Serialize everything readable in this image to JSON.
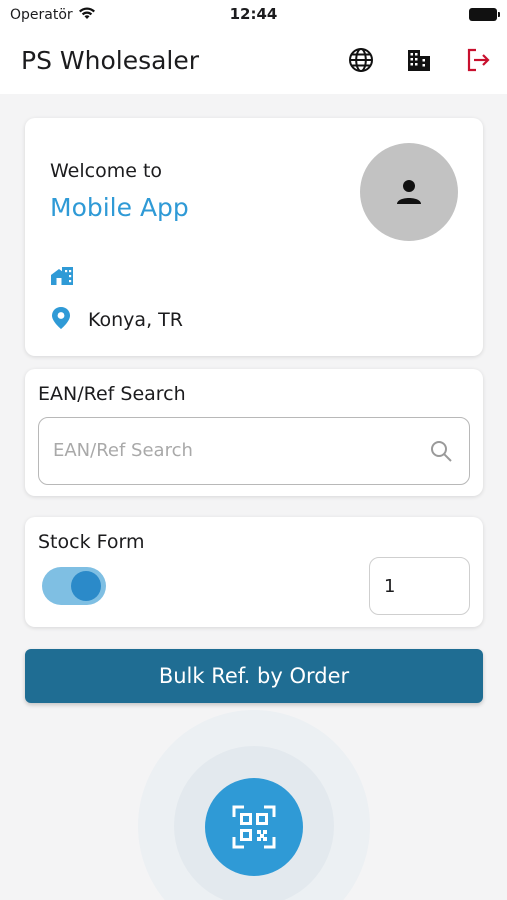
{
  "status_bar": {
    "carrier": "Operatör",
    "time": "12:44"
  },
  "app_bar": {
    "title": "PS Wholesaler",
    "icons": [
      "globe-icon",
      "company-icon",
      "logout-icon"
    ]
  },
  "welcome_card": {
    "welcome_label": "Welcome to",
    "app_name": "Mobile App",
    "location": "Konya, TR"
  },
  "search_card": {
    "title": "EAN/Ref Search",
    "placeholder": "EAN/Ref Search",
    "value": ""
  },
  "stock_card": {
    "title": "Stock Form",
    "toggle_on": true,
    "quantity": "1"
  },
  "bulk_button": {
    "label": "Bulk Ref. by Order"
  },
  "colors": {
    "accent": "#2f9ad6",
    "button": "#1f6d93",
    "logout": "#c8102e",
    "toggle_track": "#7fbfe3",
    "toggle_knob": "#2b8ac9"
  }
}
